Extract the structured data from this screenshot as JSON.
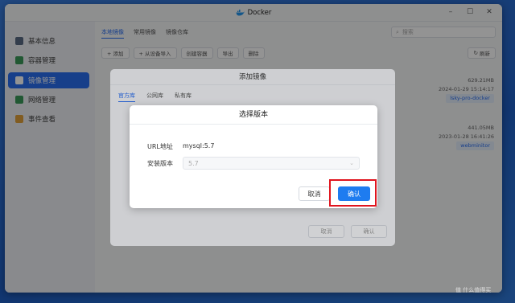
{
  "window": {
    "title": "Docker"
  },
  "sidebar": {
    "items": [
      {
        "label": "基本信息",
        "color": "#5a6a85"
      },
      {
        "label": "容器管理",
        "color": "#3a9a5b"
      },
      {
        "label": "镜像管理",
        "color": "#2a6ef0",
        "active": true
      },
      {
        "label": "网络管理",
        "color": "#3a9a5b"
      },
      {
        "label": "事件查看",
        "color": "#e0a13a"
      }
    ]
  },
  "main": {
    "tabs": [
      "本地镜像",
      "常用镜像",
      "镜像仓库"
    ],
    "search_placeholder": "搜索",
    "toolbar": [
      "+ 添加",
      "+ 从设备导入",
      "创建容器",
      "导出",
      "删除"
    ],
    "refresh_label": "刷新",
    "images": [
      {
        "size": "629.21MB",
        "date": "2024-01-29 15:14:17",
        "tag": "lsky-pro-docker"
      },
      {
        "size": "441.05MB",
        "date": "2023-01-28 16:41:26",
        "tag": "webminitor"
      }
    ]
  },
  "add_dialog": {
    "title": "添加镜像",
    "tabs": [
      "官方库",
      "公网库",
      "私有库"
    ],
    "cancel_label": "取消",
    "confirm_label": "确认"
  },
  "version_dialog": {
    "title": "选择版本",
    "url_label": "URL地址",
    "url_value": "mysql:5.7",
    "version_label": "安装版本",
    "version_value": "5.7",
    "cancel_label": "取消",
    "confirm_label": "确认",
    "confirm_color": "#1e7cf0"
  },
  "watermark": "值 什么值得买"
}
